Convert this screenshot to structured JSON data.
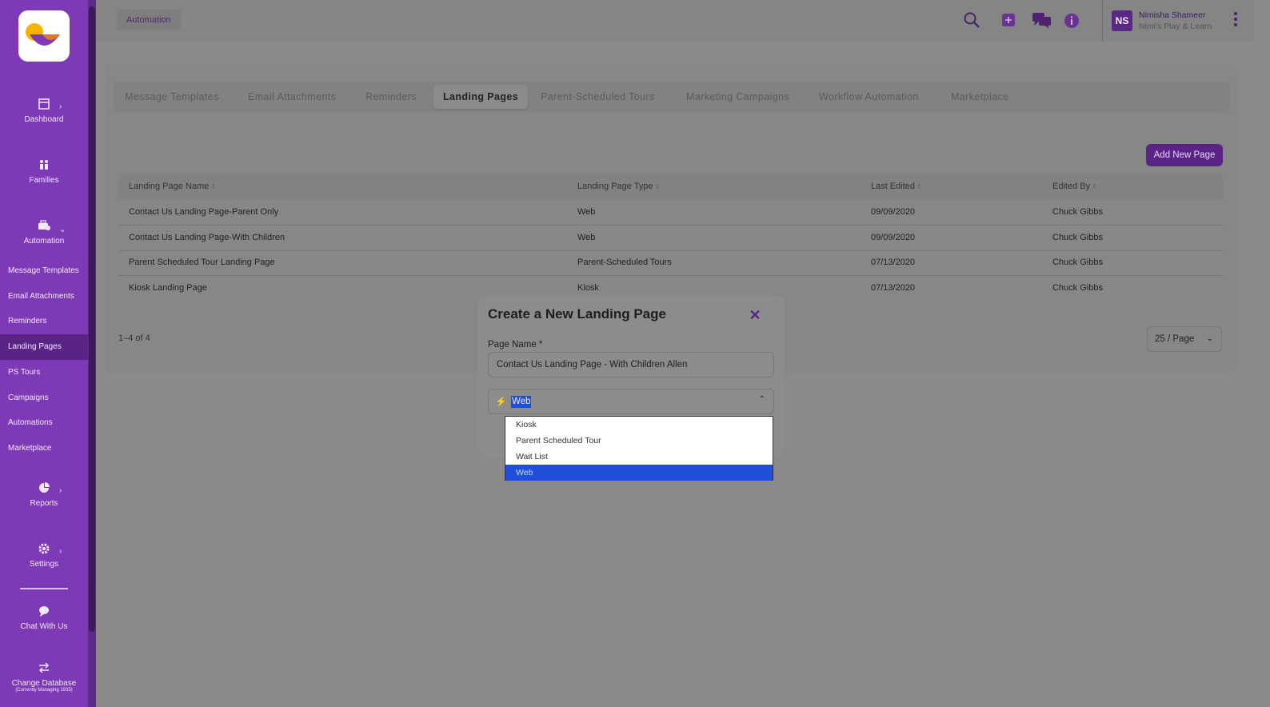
{
  "topbar": {
    "breadcrumb": "Automation",
    "user_initials": "NS",
    "user_name": "Nimisha Shameer",
    "user_org": "Nimi's Play & Learn"
  },
  "sidebar": {
    "dashboard": "Dashboard",
    "families": "Families",
    "automation": "Automation",
    "sub_items": [
      "Message Templates",
      "Email Attachments",
      "Reminders",
      "Landing Pages",
      "PS Tours",
      "Campaigns",
      "Automations",
      "Marketplace"
    ],
    "reports": "Reports",
    "settings": "Settings",
    "chat": "Chat With Us",
    "change_db": "Change Database",
    "change_db_sub": "(Currently Managing 1935)"
  },
  "tabs": [
    "Message Templates",
    "Email Attachments",
    "Reminders",
    "Landing Pages",
    "Parent-Scheduled Tours",
    "Marketing Campaigns",
    "Workflow Automation",
    "Marketplace"
  ],
  "add_button": "Add New Page",
  "table": {
    "headers": [
      "Landing Page Name",
      "Landing Page Type",
      "Last Edited",
      "Edited By"
    ],
    "rows": [
      [
        "Contact Us Landing Page-Parent Only",
        "Web",
        "09/09/2020",
        "Chuck Gibbs"
      ],
      [
        "Contact Us Landing Page-With Children",
        "Web",
        "09/09/2020",
        "Chuck Gibbs"
      ],
      [
        "Parent Scheduled Tour Landing Page",
        "Parent-Scheduled Tours",
        "07/13/2020",
        "Chuck Gibbs"
      ],
      [
        "Kiosk Landing Page",
        "Kiosk",
        "07/13/2020",
        "Chuck Gibbs"
      ]
    ],
    "count": "1–4 of 4",
    "page_size": "25 / Page"
  },
  "modal": {
    "title": "Create a New Landing Page",
    "page_name_label": "Page Name *",
    "page_name_value": "Contact Us Landing Page - With Children Allen",
    "type_value": "Web",
    "options": [
      "Kiosk",
      "Parent Scheduled Tour",
      "Wait List",
      "Web"
    ]
  }
}
